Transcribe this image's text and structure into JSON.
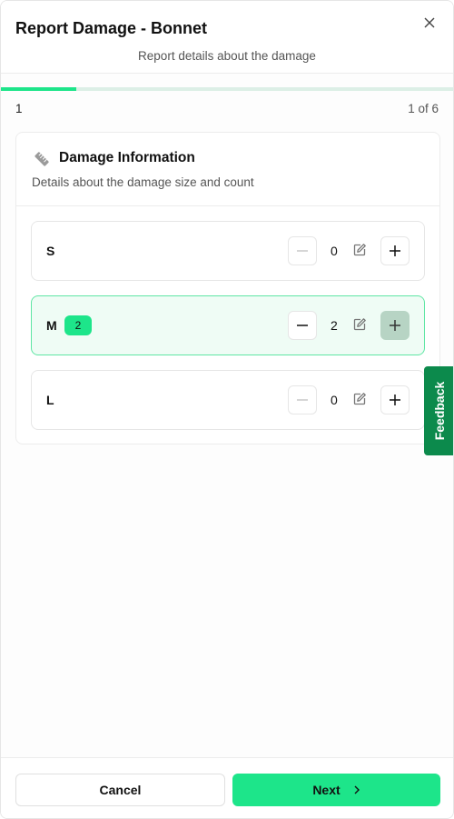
{
  "header": {
    "title": "Report Damage - Bonnet",
    "subtitle": "Report details about the damage",
    "close_icon": "close-icon"
  },
  "progress": {
    "current_step": "1",
    "step_of": "1 of 6",
    "fraction": 0.1667
  },
  "card": {
    "icon": "ruler-icon",
    "title": "Damage Information",
    "description": "Details about the damage size and count"
  },
  "sizes": [
    {
      "label": "S",
      "count": "0",
      "badge": "",
      "active": false
    },
    {
      "label": "M",
      "count": "2",
      "badge": "2",
      "active": true
    },
    {
      "label": "L",
      "count": "0",
      "badge": "",
      "active": false
    }
  ],
  "feedback": {
    "label": "Feedback"
  },
  "footer": {
    "cancel_label": "Cancel",
    "next_label": "Next"
  },
  "colors": {
    "accent": "#1de58a",
    "feedback": "#0c8a4c",
    "active_row_bg": "#effcf5"
  }
}
